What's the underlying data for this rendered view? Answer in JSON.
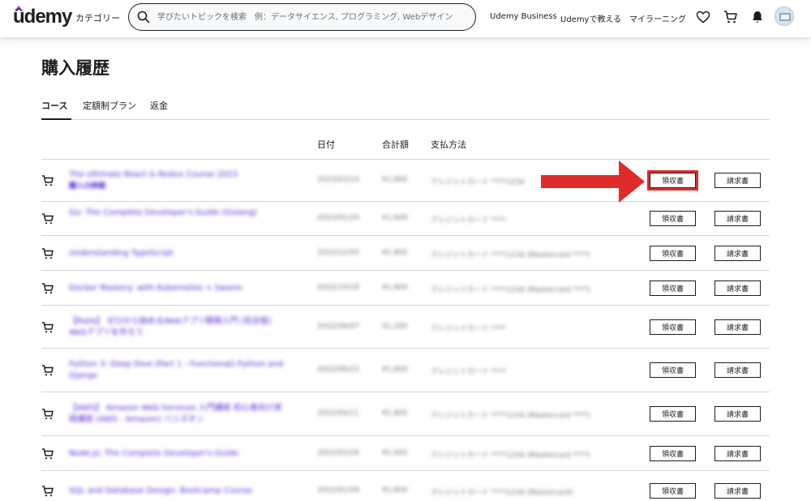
{
  "header": {
    "logo": "ûdemy",
    "categories": "カテゴリー",
    "search_placeholder": "学びたいトピックを検索　例：データサイエンス, プログラミング, Webデザイン",
    "links": [
      "Udemy Business",
      "Udemyで教える",
      "マイラーニング"
    ]
  },
  "page": {
    "title": "購入履歴",
    "tabs": [
      "コース",
      "定額制プラン",
      "返金"
    ],
    "active_tab": "コース"
  },
  "table": {
    "headers": {
      "date": "日付",
      "total": "合計額",
      "payment": "支払方法"
    },
    "receipt_label": "領収書",
    "invoice_label": "請求書",
    "rows": [
      {
        "course": "The Ultimate React & Redux Course 2023",
        "sub": "購入の詳細",
        "date": "2023/03/15",
        "total": "¥1,800",
        "payment": "クレジットカード ****1234"
      },
      {
        "course": "Go: The Complete Developer's Guide (Golang)",
        "sub": "",
        "date": "2023/01/20",
        "total": "¥1,600",
        "payment": "クレジットカード ****"
      },
      {
        "course": "Understanding TypeScript",
        "sub": "",
        "date": "2022/12/05",
        "total": "¥1,800",
        "payment": "クレジットカード ****1234 (Mastercard ****)"
      },
      {
        "course": "Docker Mastery: with Kubernetes + Swarm",
        "sub": "",
        "date": "2022/10/18",
        "total": "¥1,600",
        "payment": "クレジットカード ****1234 (Mastercard ****)"
      },
      {
        "course": "【Rails】 ゼロから始めるWebアプリ開発入門 (完全版) Webアプリを作ろう",
        "sub": "",
        "date": "2022/08/07",
        "total": "¥1,200",
        "payment": "クレジットカード ****"
      },
      {
        "course": "Python 3: Deep Dive (Part 1 - Functional) Python and Django",
        "sub": "",
        "date": "2022/06/22",
        "total": "¥1,800",
        "payment": "クレジットカード ****"
      },
      {
        "course": "【AWS】 Amazon Web Services 入門講座 初心者向け実践講座 (AWS - Amazon) ハンズオン",
        "sub": "",
        "date": "2022/04/11",
        "total": "¥1,800",
        "payment": "クレジットカード ****1234 (Mastercard ****)"
      },
      {
        "course": "Node.js: The Complete Developer's Guide",
        "sub": "",
        "date": "2022/02/28",
        "total": "¥1,600",
        "payment": "クレジットカード ****1234 (Mastercard ****)"
      },
      {
        "course": "SQL and Database Design: Bootcamp Course",
        "sub": "",
        "date": "2022/01/09",
        "total": "¥1,800",
        "payment": "クレジットカード ****1234 (Mastercard)"
      }
    ]
  }
}
